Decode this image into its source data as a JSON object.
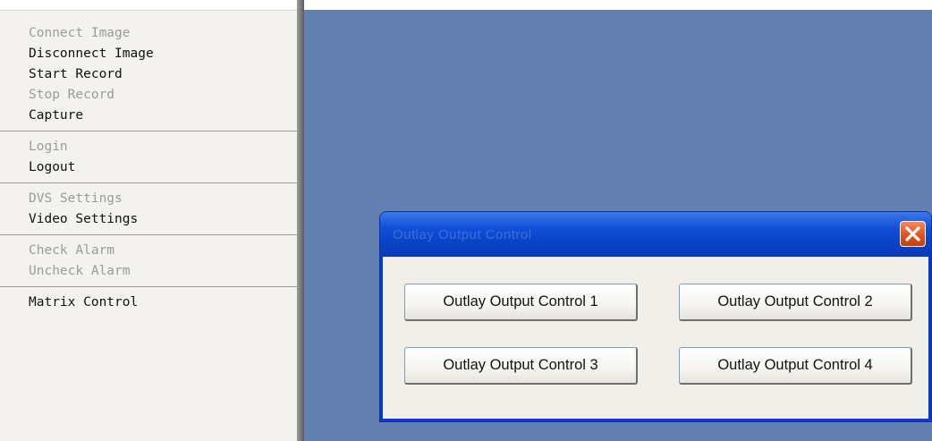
{
  "menu": {
    "groups": [
      {
        "items": [
          {
            "label": "Connect Image",
            "enabled": false
          },
          {
            "label": "Disconnect Image",
            "enabled": true
          },
          {
            "label": "Start Record",
            "enabled": true
          },
          {
            "label": "Stop Record",
            "enabled": false
          },
          {
            "label": "Capture",
            "enabled": true
          }
        ]
      },
      {
        "items": [
          {
            "label": "Login",
            "enabled": false
          },
          {
            "label": "Logout",
            "enabled": true
          }
        ]
      },
      {
        "items": [
          {
            "label": "DVS Settings",
            "enabled": false
          },
          {
            "label": "Video Settings",
            "enabled": true
          }
        ]
      },
      {
        "items": [
          {
            "label": "Check Alarm",
            "enabled": false
          },
          {
            "label": "Uncheck Alarm",
            "enabled": false
          }
        ]
      },
      {
        "items": [
          {
            "label": "Matrix Control",
            "enabled": true
          }
        ]
      }
    ]
  },
  "dialog": {
    "title": "Outlay Output Control",
    "buttons": [
      "Outlay Output Control 1",
      "Outlay Output Control 2",
      "Outlay Output Control 3",
      "Outlay Output Control 4"
    ]
  },
  "colors": {
    "desktop": "#6480b0",
    "titlebar": "#0a3bc7",
    "close": "#e25822"
  },
  "icons": {
    "close": "close-x-icon"
  }
}
